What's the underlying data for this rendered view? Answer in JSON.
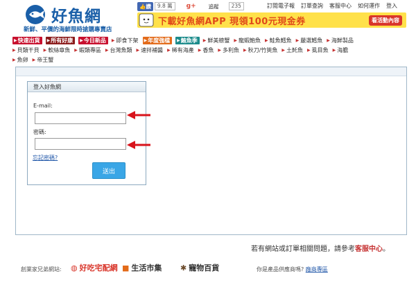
{
  "header": {
    "logo_title": "好魚網",
    "slogan": "新鮮、平價的海鮮限時搶購專賣店",
    "like_label": "讚",
    "like_count": "9.8 萬",
    "follow_label": "追蹤",
    "follow_count": "235",
    "top_links": [
      "訂閱電子報",
      "訂單查詢",
      "客服中心",
      "如何運作",
      "登入"
    ],
    "banner_text": "下載好魚網APP 現領100元現金券",
    "banner_button": "看活動內容"
  },
  "nav": {
    "row1": [
      {
        "label": "快速出貨",
        "style": "red"
      },
      {
        "label": "所有好康",
        "style": "dark"
      },
      {
        "label": "今日新品",
        "style": "red"
      },
      {
        "label": "即食下架",
        "style": "plain"
      },
      {
        "label": "年度強檔",
        "style": "orange"
      },
      {
        "label": "鮪魚季",
        "style": "teal"
      },
      {
        "label": "鮮美螃蟹",
        "style": "plain"
      },
      {
        "label": "龍蝦鮑魚",
        "style": "plain"
      },
      {
        "label": "鮭魚鱈魚",
        "style": "plain"
      },
      {
        "label": "嚴選鱈魚",
        "style": "plain"
      },
      {
        "label": "海鮮製品",
        "style": "plain"
      }
    ],
    "row2": [
      "貝類干貝",
      "軟絲章魚",
      "蝦類專區",
      "台灣魚類",
      "速拌補醬",
      "稀有海產",
      "香魚",
      "多利魚",
      "秋刀/竹筴魚",
      "土魠魚",
      "虱目魚",
      "海膽"
    ],
    "row3": [
      "魚卵",
      "帝王蟹"
    ]
  },
  "login": {
    "box_title": "登入好魚網",
    "email_label": "E-mail:",
    "email_value": "",
    "password_label": "密碼:",
    "password_value": "",
    "forgot_label": "忘記密碼?",
    "submit_label": "送出"
  },
  "footer": {
    "help_prefix": "若有網站或訂單相關問題，請參考",
    "help_link": "客服中心",
    "help_suffix": "。",
    "partners_label": "創業家兄弟網站:",
    "partners": [
      "好吃宅配網",
      "生活市集",
      "寵物百貨"
    ],
    "shop_question": "你是產品供應商嗎?",
    "shop_link": "廠商專區"
  },
  "colors": {
    "brand_blue": "#1a5fa8",
    "accent_red": "#c8102e",
    "button_blue": "#3aa6e6",
    "banner_yellow": "#ffe14a"
  }
}
